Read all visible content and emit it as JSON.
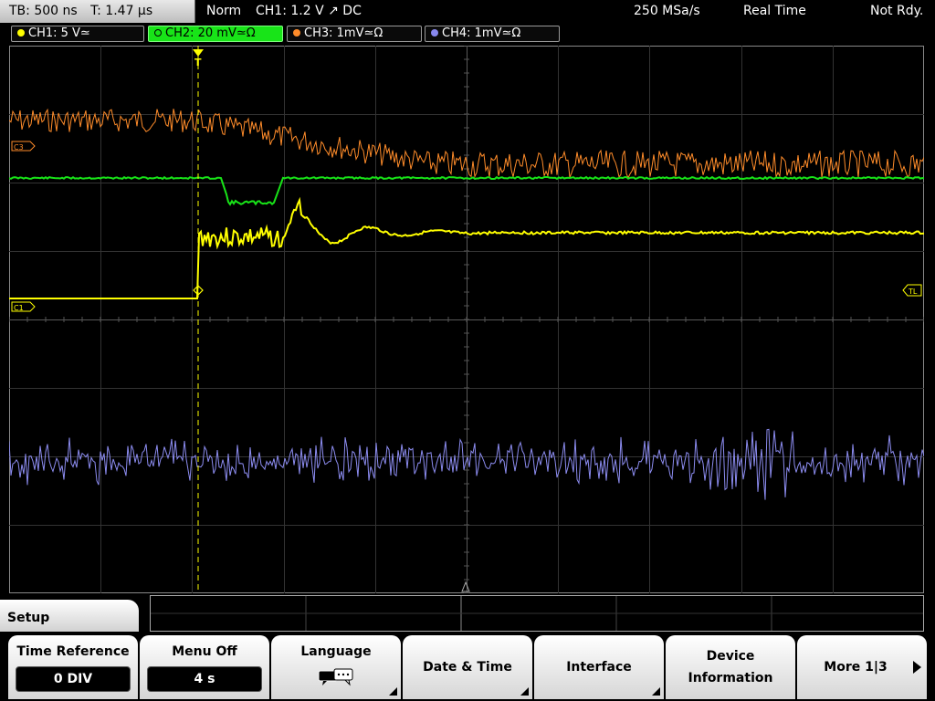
{
  "status_bar": {
    "timebase": "TB: 500 ns",
    "trigger_time": "T: 1.47 µs",
    "trigger_mode": "Norm",
    "trigger_info": "CH1: 1.2 V ↗ DC",
    "sample_rate": "250 MSa/s",
    "acq_mode": "Real Time",
    "state": "Not Rdy."
  },
  "channels": [
    {
      "label": "CH1: 5 V≃",
      "color": "#ffff00",
      "active": false
    },
    {
      "label": "CH2: 20 mV≃Ω",
      "color": "#18e418",
      "active": true
    },
    {
      "label": "CH3: 1mV≃Ω",
      "color": "#ff8c2a",
      "active": false
    },
    {
      "label": "CH4: 1mV≃Ω",
      "color": "#8888ee",
      "active": false
    }
  ],
  "markers": {
    "c3": "C3",
    "c1": "C1",
    "tl": "TL"
  },
  "menu": {
    "title": "Setup",
    "time_reference": {
      "label": "Time Reference",
      "value": "0 DIV"
    },
    "menu_off": {
      "label": "Menu Off",
      "value": "4 s"
    },
    "language": {
      "label": "Language",
      "icon": "speech-bubble-icon"
    },
    "date_time": {
      "label": "Date & Time"
    },
    "interface": {
      "label": "Interface"
    },
    "device_info": {
      "line1": "Device",
      "line2": "Information"
    },
    "more": {
      "label": "More 1|3"
    }
  }
}
